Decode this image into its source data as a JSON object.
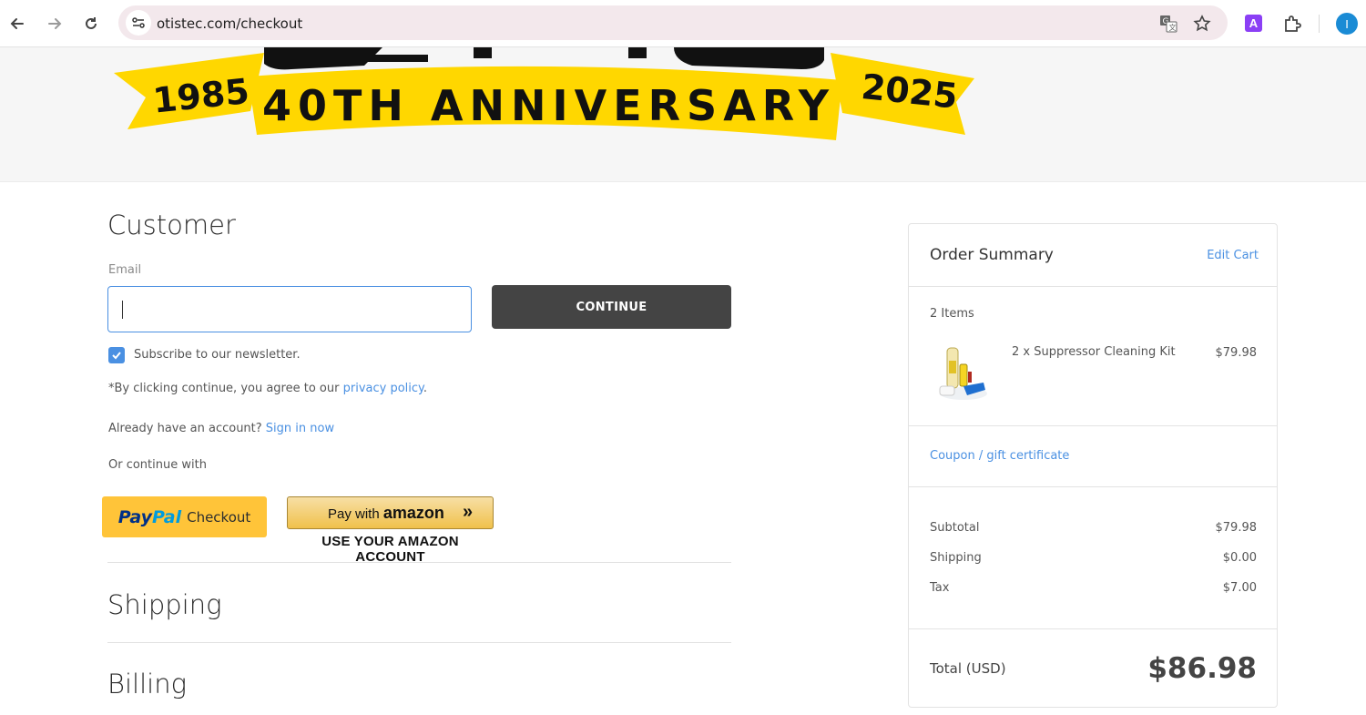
{
  "browser": {
    "url": "otistec.com/checkout",
    "profile_initial": "I",
    "extension_label": "A",
    "icons": [
      "back-icon",
      "forward-icon",
      "reload-icon",
      "site-settings-icon",
      "translate-icon",
      "bookmark-star-icon",
      "extension-icon",
      "puzzle-icon"
    ]
  },
  "banner": {
    "year_left": "1985",
    "headline": "40TH ANNIVERSARY",
    "year_right": "2025",
    "colors": {
      "ribbon": "#ffd700",
      "text": "#111111"
    }
  },
  "customer": {
    "title": "Customer",
    "email_label": "Email",
    "email_value": "",
    "continue_label": "CONTINUE",
    "subscribe_label": "Subscribe to our newsletter.",
    "subscribe_checked": true,
    "agree_prefix": "*By clicking continue, you agree to our ",
    "agree_link": "privacy policy",
    "agree_suffix": ".",
    "account_prefix": "Already have an account? ",
    "account_link": "Sign in now",
    "or_continue": "Or continue with",
    "paypal": {
      "pay": "Pay",
      "pal": "Pal",
      "checkout": "Checkout"
    },
    "amazon": {
      "pay_with": "Pay with",
      "brand": "amazon",
      "arrows": "»",
      "caption": "USE YOUR AMAZON ACCOUNT"
    }
  },
  "sections": {
    "shipping": "Shipping",
    "billing": "Billing"
  },
  "summary": {
    "title": "Order Summary",
    "edit_cart": "Edit Cart",
    "items_count": "2 Items",
    "product_name": "2 x Suppressor Cleaning Kit",
    "product_price": "$79.98",
    "coupon": "Coupon / gift certificate",
    "subtotal_label": "Subtotal",
    "subtotal_value": "$79.98",
    "shipping_label": "Shipping",
    "shipping_value": "$0.00",
    "tax_label": "Tax",
    "tax_value": "$7.00",
    "total_label": "Total (USD)",
    "total_value": "$86.98"
  },
  "colors": {
    "accent": "#4a90e2",
    "continue_button": "#444444",
    "paypal": "#ffc439",
    "amazon": "#f0c14b"
  }
}
